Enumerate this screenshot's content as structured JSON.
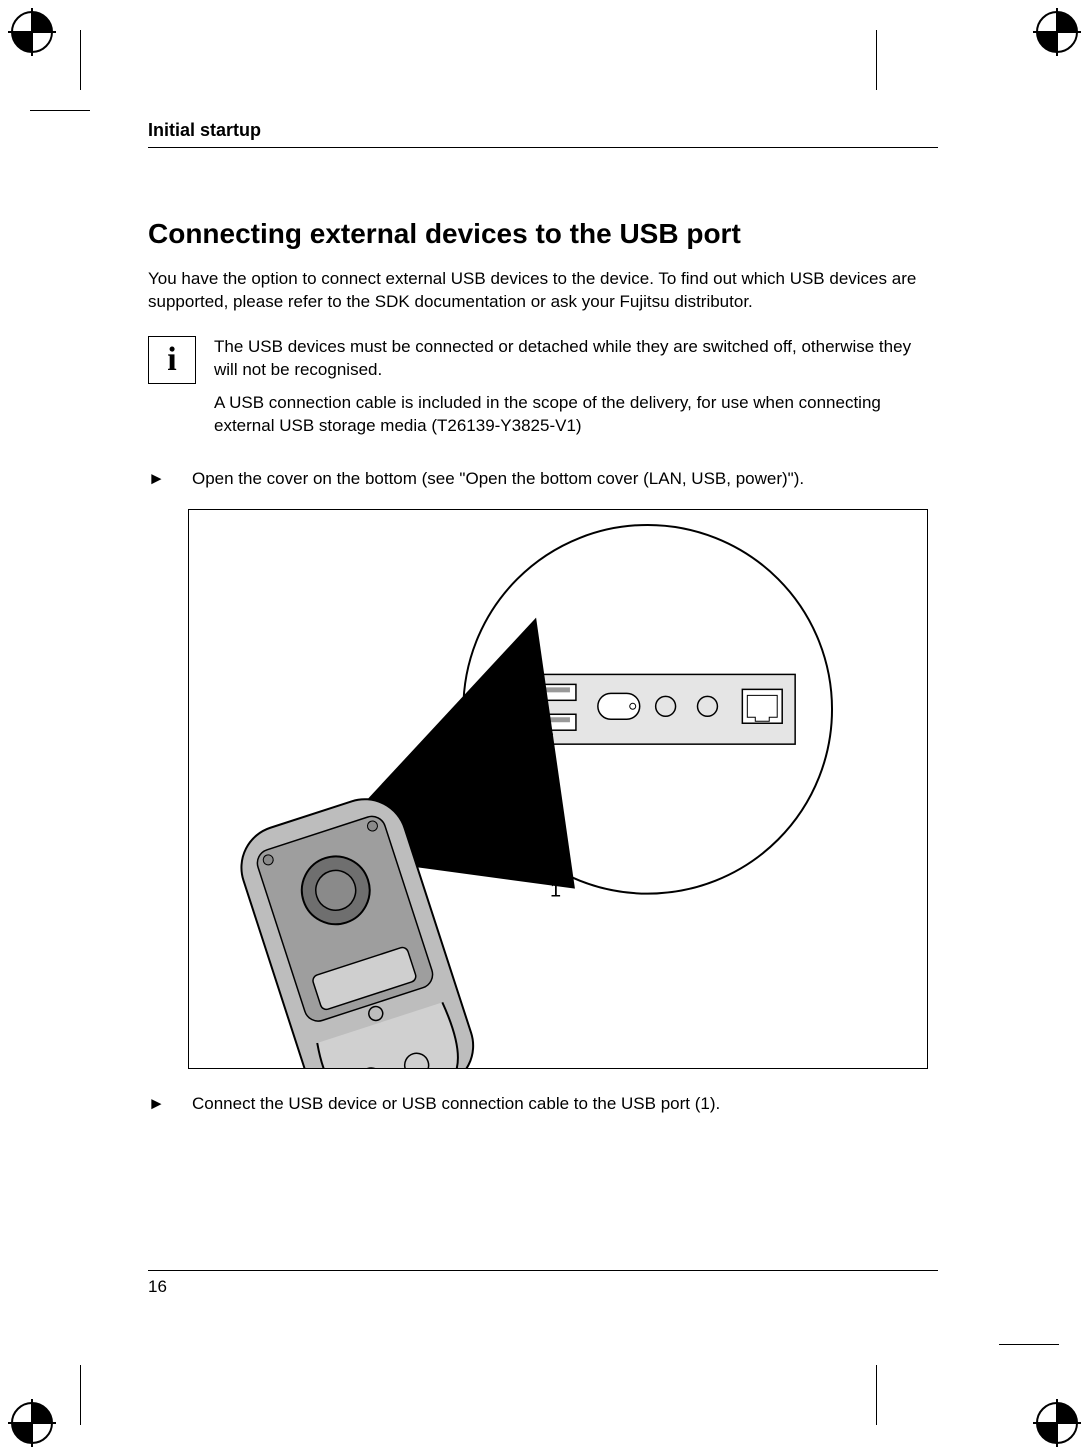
{
  "running_head": "Initial startup",
  "heading": "Connecting external devices to the USB port",
  "intro": "You have the option to connect external USB devices to the device. To find out which USB devices are supported, please refer to the SDK documentation or ask your Fujitsu distributor.",
  "info": {
    "icon_glyph": "i",
    "para1": "The USB devices must be connected or detached while they are switched off, otherwise they will not be recognised.",
    "para2": "A USB connection cable is included in the scope of the delivery, for use when connecting external USB storage media (T26139-Y3825-V1)"
  },
  "step1": "Open the cover on the bottom (see \"Open the bottom cover (LAN, USB, power)\").",
  "figure_callout": "1",
  "step2": "Connect the USB device or USB connection cable to the USB port (1).",
  "page_number": "16",
  "step_marker": "►"
}
